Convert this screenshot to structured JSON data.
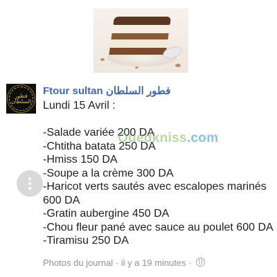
{
  "post": {
    "page_name": "Ftour sultan فطور السلطان",
    "lines": [
      "Lundi 15 Avril :",
      "",
      "-Salade variée 200 DA",
      "-Chtitha batata 250 DA",
      "-Hmiss 150 DA",
      "-Soupe a la crème 300 DA",
      "-Haricot verts sautés avec escalopes marinés 600 DA",
      "-Gratin aubergine 450 DA",
      "-Chou fleur pané avec sauce au poulet 600 DA",
      "-Tiramisu 250 DA"
    ],
    "meta": "Photos du journal · il y a 19 minutes ·"
  },
  "avatar": {
    "logo_text": "فطور السلطان"
  },
  "watermark": {
    "brand": "Ouedkniss",
    "suffix": ".com"
  },
  "icons": {
    "more": "more-vertical-icon",
    "privacy": "globe-icon"
  },
  "colors": {
    "link": "#4267b2",
    "meta": "#8d949e",
    "watermark": "#1f98d6"
  }
}
